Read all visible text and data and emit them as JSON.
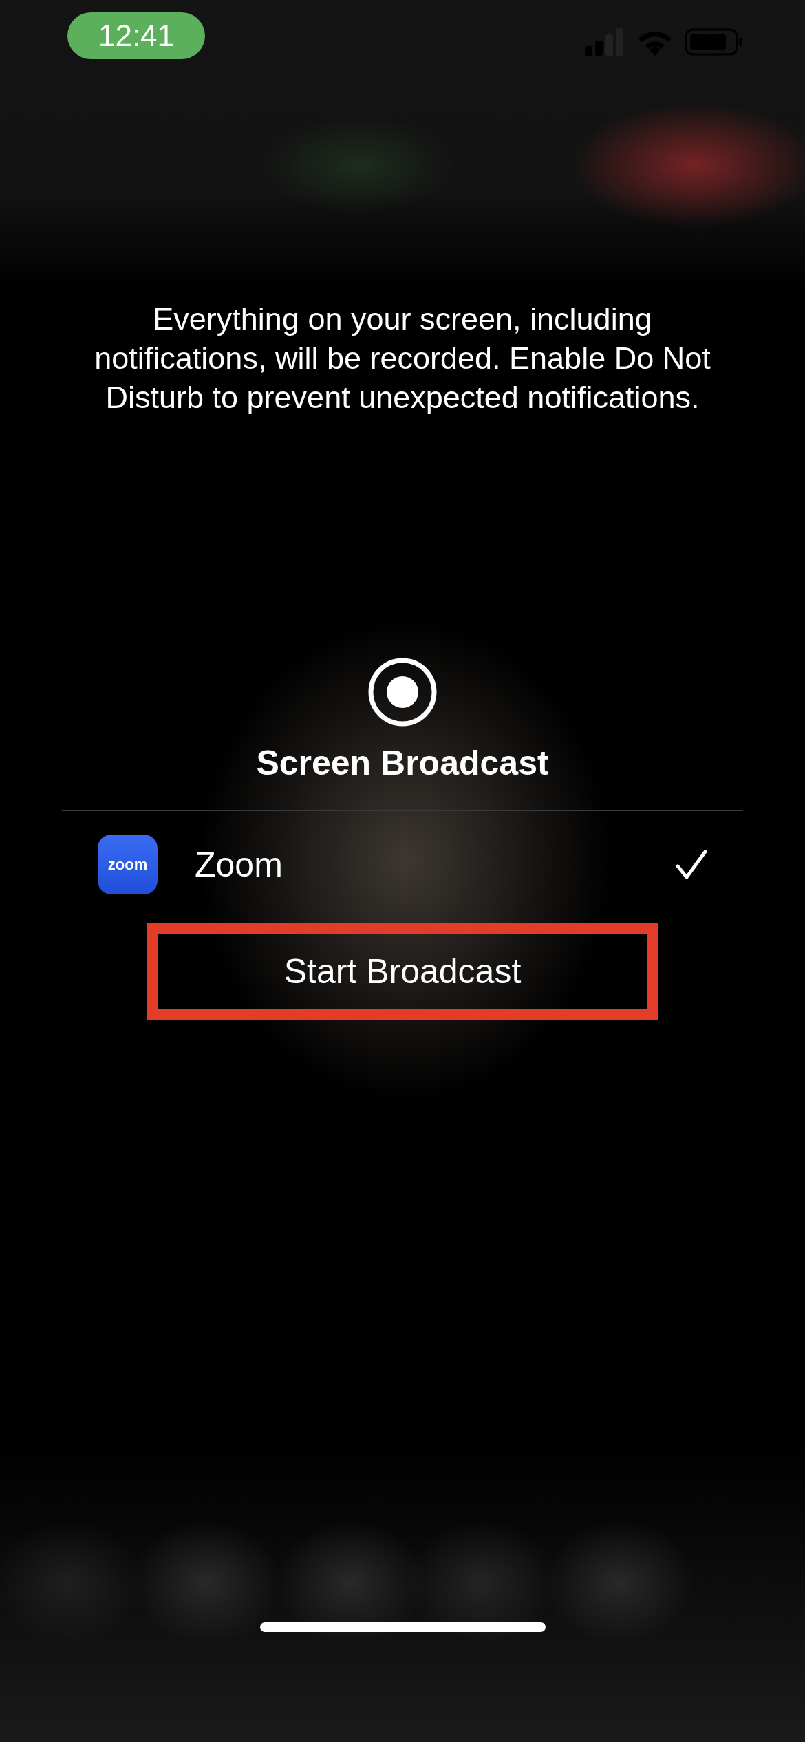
{
  "status_bar": {
    "time": "12:41"
  },
  "message": "Everything on your screen, including notifications, will be recorded. Enable Do Not Disturb to prevent unexpected notifications.",
  "title": "Screen Broadcast",
  "apps": [
    {
      "name": "Zoom",
      "icon_label": "zoom",
      "selected": true
    }
  ],
  "start_button": {
    "label": "Start Broadcast",
    "highlighted": true
  }
}
